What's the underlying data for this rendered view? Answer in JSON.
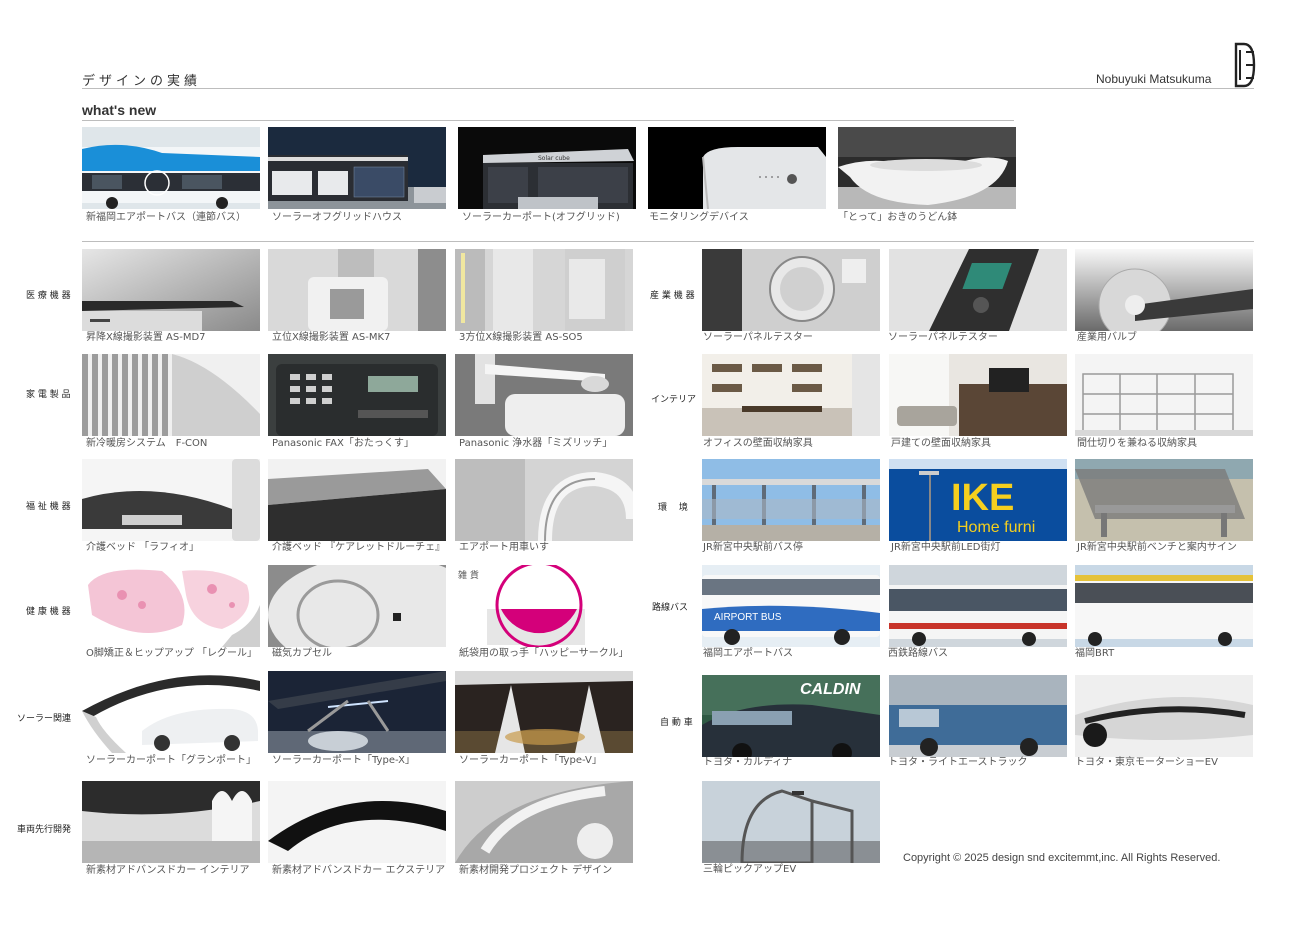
{
  "header": {
    "title": "デザインの実績",
    "author": "Nobuyuki Matsukuma",
    "logo_text": "DE"
  },
  "whats_new": {
    "title": "what's new",
    "items": [
      {
        "caption": "新福岡エアポートバス（連節バス）",
        "icon": "bus-photo"
      },
      {
        "caption": "ソーラーオフグリッドハウス",
        "icon": "house-photo"
      },
      {
        "caption": "ソーラーカーポート(オフグリッド)",
        "icon": "carport-photo"
      },
      {
        "caption": "モニタリングデバイス",
        "icon": "device-photo"
      },
      {
        "caption": "「とって」おきのうどん鉢",
        "icon": "bowl-photo"
      }
    ]
  },
  "left_categories": [
    {
      "label": "医 療 機 器",
      "items": [
        "昇降X線撮影装置 AS-MD7",
        "立位X線撮影装置 AS-MK7",
        "3方位X線撮影装置 AS-SO5"
      ]
    },
    {
      "label": "家 電 製 品",
      "items": [
        "新冷暖房システム　F-CON",
        "Panasonic FAX「おたっくす」",
        "Panasonic 浄水器「ミズリッチ」"
      ]
    },
    {
      "label": "福 祉 機 器",
      "items": [
        "介護ベッド 「ラフィオ」",
        "介護ベッド 『ケアレットドルーチェ』",
        "エアポート用車いす"
      ]
    },
    {
      "label": "健 康 機 器",
      "items": [
        "O脚矯正＆ヒップアップ 「レグール」",
        "磁気カプセル",
        "紙袋用の取っ手「ハッピーサークル」"
      ]
    },
    {
      "label": "ソーラー関連",
      "items": [
        "ソーラーカーポート「グランポート」",
        "ソーラーカーポート「Type-X」",
        "ソーラーカーポート「Type-V」"
      ]
    },
    {
      "label": "車両先行開発",
      "items": [
        "新素材アドバンスドカー インテリア",
        "新素材アドバンスドカー エクステリア",
        "新素材開発プロジェクト デザイン"
      ]
    }
  ],
  "right_categories": [
    {
      "label": "産 業 機 器",
      "items": [
        "ソーラーパネルテスター",
        "ソーラーパネルテスター",
        "産業用バルブ"
      ]
    },
    {
      "label": "インテリア",
      "items": [
        "オフィスの壁面収納家具",
        "戸建ての壁面収納家具",
        "間仕切りを兼ねる収納家具"
      ]
    },
    {
      "label": "環　 境",
      "items": [
        "JR新宮中央駅前バス停",
        "JR新宮中央駅前LED街灯",
        "JR新宮中央駅前ベンチと案内サイン"
      ]
    },
    {
      "label": "路線バス",
      "items": [
        "福岡エアポートバス",
        "西鉄路線バス",
        "福岡BRT"
      ]
    },
    {
      "label": "自 動 車",
      "items": [
        "トヨタ・カルディナ",
        "トヨタ・ライトエーストラック",
        "トヨタ・東京モーターショーEV"
      ]
    },
    {
      "label": "",
      "items": [
        "三輪ピックアップEV"
      ]
    }
  ],
  "image_texts": {
    "zakka": "雑 貨",
    "ikea": "IKE",
    "ikea_sub": "Home furni",
    "caldina": "CALDIN",
    "airport_bus": "AIRPORT BUS"
  },
  "footer": {
    "copyright": "Copyright © 2025 design snd excitemmt,inc. All Rights Reserved."
  },
  "colors": {
    "accent_magenta": "#d4007a",
    "ikea_blue": "#0a4d9e",
    "ikea_yellow": "#f5cf1e",
    "text": "#333333",
    "rule": "#bdbdbd"
  }
}
